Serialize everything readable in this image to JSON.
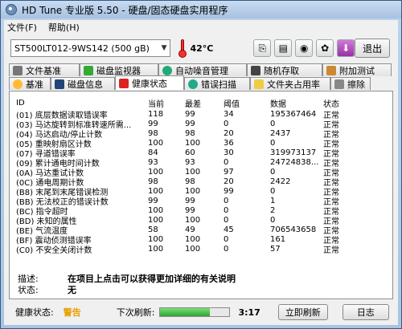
{
  "window": {
    "title": "HD Tune 专业版 5.50 - 硬盘/固态硬盘实用程序"
  },
  "menu": [
    "文件(F)",
    "帮助(H)"
  ],
  "toolbar": {
    "drive": "ST500LT012-9WS142 (500 gB)",
    "temperature": "42°C",
    "exit_label": "退出"
  },
  "tabs_row1": [
    "文件基准",
    "磁盘监视器",
    "自动噪音管理",
    "随机存取",
    "附加测试"
  ],
  "tabs_row2": [
    "基准",
    "磁盘信息",
    "健康状态",
    "错误扫描",
    "文件夹占用率",
    "擦除"
  ],
  "columns": [
    "ID",
    "当前",
    "最差",
    "阈值",
    "数据",
    "状态"
  ],
  "rows": [
    [
      "(01) 底层数据读取错误率",
      "118",
      "99",
      "34",
      "195367464",
      "正常"
    ],
    [
      "(03) 马达旋转到标准转速所需...",
      "99",
      "99",
      "0",
      "0",
      "正常"
    ],
    [
      "(04) 马达启动/停止计数",
      "98",
      "98",
      "20",
      "2437",
      "正常"
    ],
    [
      "(05) 重映射扇区计数",
      "100",
      "100",
      "36",
      "0",
      "正常"
    ],
    [
      "(07) 寻道错误率",
      "84",
      "60",
      "30",
      "319973137",
      "正常"
    ],
    [
      "(09) 累计通电时间计数",
      "93",
      "93",
      "0",
      "24724838...",
      "正常"
    ],
    [
      "(0A) 马达重试计数",
      "100",
      "100",
      "97",
      "0",
      "正常"
    ],
    [
      "(0C) 通电周期计数",
      "98",
      "98",
      "20",
      "2422",
      "正常"
    ],
    [
      "(B8) 末尾到末尾错误检测",
      "100",
      "100",
      "99",
      "0",
      "正常"
    ],
    [
      "(BB) 无法校正的错误计数",
      "99",
      "99",
      "0",
      "1",
      "正常"
    ],
    [
      "(BC) 指令超时",
      "100",
      "99",
      "0",
      "2",
      "正常"
    ],
    [
      "(BD) 未知的属性",
      "100",
      "100",
      "0",
      "0",
      "正常"
    ],
    [
      "(BE) 气流温度",
      "58",
      "49",
      "45",
      "706543658",
      "正常"
    ],
    [
      "(BF) 震动侦测错误率",
      "100",
      "100",
      "0",
      "161",
      "正常"
    ],
    [
      "(C0) 不安全关闭计数",
      "100",
      "100",
      "0",
      "57",
      "正常"
    ]
  ],
  "description": {
    "desc_label": "描述:",
    "desc_value": "在项目上点击可以获得更加详细的有关说明",
    "status_label": "状态:",
    "status_value": "无"
  },
  "statusbar": {
    "health_label": "健康状态:",
    "health_value": "警告",
    "next_refresh_label": "下次刷新:",
    "progress": 0.72,
    "timer": "3:17",
    "refresh_label": "立即刷新",
    "log_label": "日志"
  },
  "colors": {
    "warning": "#e8a000",
    "progress": "#2fa42f"
  }
}
